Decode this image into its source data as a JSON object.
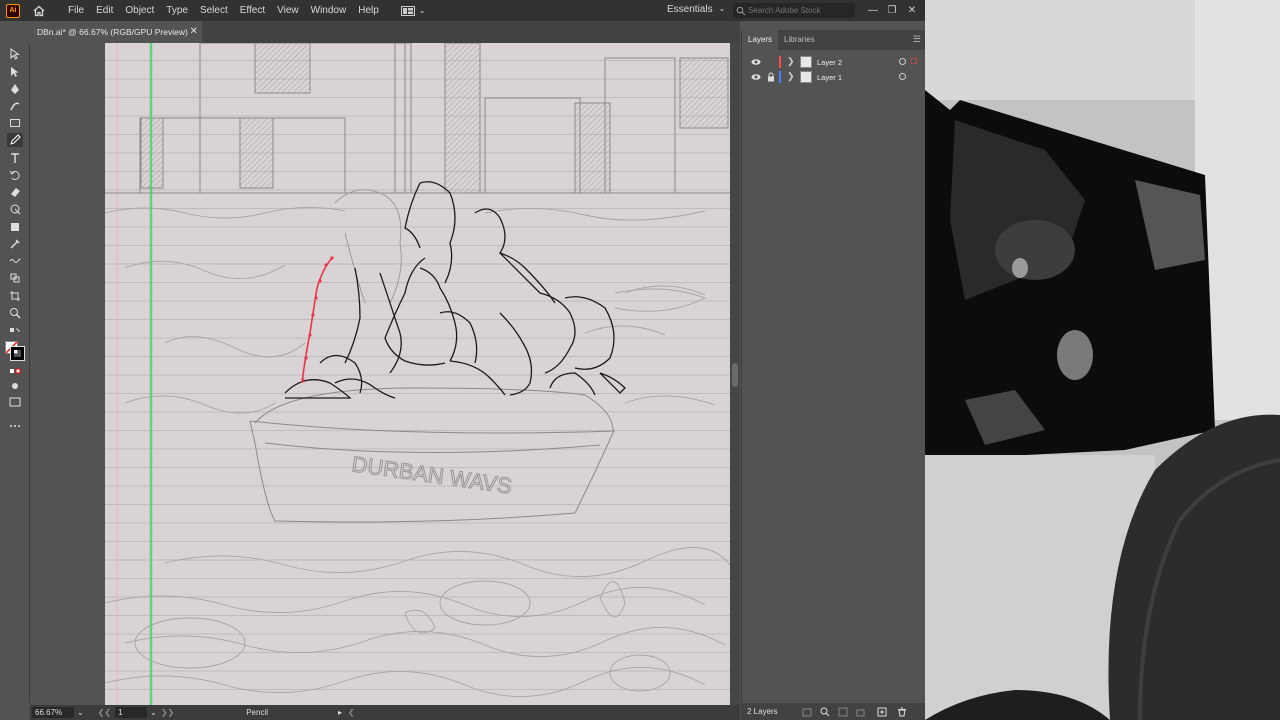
{
  "app": {
    "logo": "Ai",
    "accent_color": "#ff9a00"
  },
  "menu": [
    "File",
    "Edit",
    "Object",
    "Type",
    "Select",
    "Effect",
    "View",
    "Window",
    "Help"
  ],
  "workspace": {
    "label": "Essentials"
  },
  "stock_search": {
    "placeholder": "Search Adobe Stock"
  },
  "document_tab": {
    "title": "DBn.ai* @ 66.67% (RGB/GPU Preview)"
  },
  "tools": [
    "selection-tool",
    "direct-selection-tool",
    "pen-tool",
    "curvature-tool",
    "rectangle-tool",
    "pencil-tool",
    "type-tool",
    "rotate-tool",
    "eraser-tool",
    "warp-tool",
    "free-transform-tool",
    "shape-builder-tool",
    "eyedropper-tool",
    "blend-tool",
    "symbol-sprayer-tool",
    "artboard-tool",
    "zoom-tool"
  ],
  "canvas": {
    "drawing_text": "DURBAN WAVS"
  },
  "status": {
    "zoom": "66.67%",
    "artboard": "1",
    "tool": "Pencil"
  },
  "layers_panel": {
    "tabs": [
      "Layers",
      "Libraries"
    ],
    "layers": [
      {
        "name": "Layer 2",
        "color": "#ff4b4b",
        "locked": false
      },
      {
        "name": "Layer 1",
        "color": "#4b7bff",
        "locked": true
      }
    ],
    "footer_count": "2 Layers"
  }
}
